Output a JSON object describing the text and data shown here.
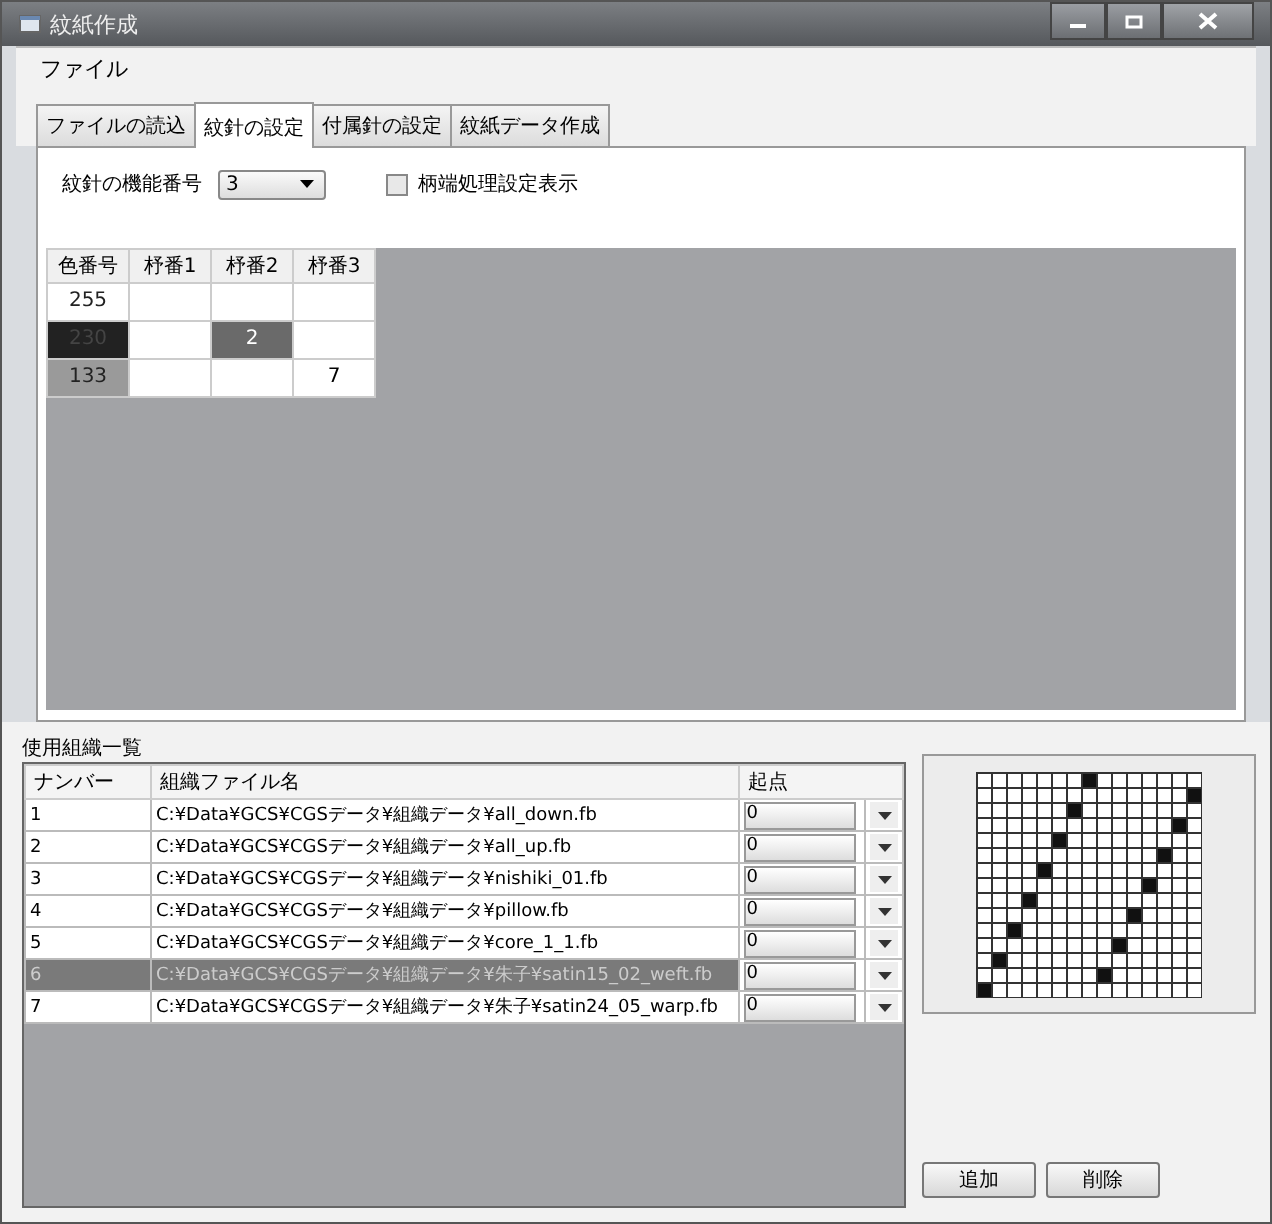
{
  "window": {
    "title": "紋紙作成"
  },
  "menu": [
    "ファイル"
  ],
  "tabs": [
    {
      "label": "ファイルの読込",
      "selected": false
    },
    {
      "label": "紋針の設定",
      "selected": true
    },
    {
      "label": "付属針の設定",
      "selected": false
    },
    {
      "label": "紋紙データ作成",
      "selected": false
    }
  ],
  "needle_function": {
    "label": "紋針の機能番号",
    "value": "3"
  },
  "edge_option": {
    "label": "柄端処理設定表示",
    "checked": false
  },
  "color_grid": {
    "columns": [
      "色番号",
      "杼番1",
      "杼番2",
      "杼番3"
    ],
    "rows": [
      {
        "color": "#ffffff",
        "cells": [
          {
            "text": "255",
            "selected": false
          },
          {
            "text": "",
            "selected": false
          },
          {
            "text": "",
            "selected": false
          },
          {
            "text": "",
            "selected": false
          }
        ]
      },
      {
        "color": "#222222",
        "cells": [
          {
            "text": "230",
            "selected": false
          },
          {
            "text": "",
            "selected": false
          },
          {
            "text": "2",
            "selected": true
          },
          {
            "text": "",
            "selected": false
          }
        ]
      },
      {
        "color": "#9a9a9a",
        "cells": [
          {
            "text": "133",
            "selected": false
          },
          {
            "text": "",
            "selected": false
          },
          {
            "text": "",
            "selected": false
          },
          {
            "text": "7",
            "selected": false
          }
        ]
      }
    ]
  },
  "weave_list": {
    "title": "使用組織一覧",
    "columns": [
      "ナンバー",
      "組織ファイル名",
      "起点"
    ],
    "rows": [
      {
        "number": "1",
        "file": "C:¥Data¥GCS¥CGSデータ¥組織データ¥all_down.fb",
        "origin": "0",
        "selected": false
      },
      {
        "number": "2",
        "file": "C:¥Data¥GCS¥CGSデータ¥組織データ¥all_up.fb",
        "origin": "0",
        "selected": false
      },
      {
        "number": "3",
        "file": "C:¥Data¥GCS¥CGSデータ¥組織データ¥nishiki_01.fb",
        "origin": "0",
        "selected": false
      },
      {
        "number": "4",
        "file": "C:¥Data¥GCS¥CGSデータ¥組織データ¥pillow.fb",
        "origin": "0",
        "selected": false
      },
      {
        "number": "5",
        "file": "C:¥Data¥GCS¥CGSデータ¥組織データ¥core_1_1.fb",
        "origin": "0",
        "selected": false
      },
      {
        "number": "6",
        "file": "C:¥Data¥GCS¥CGSデータ¥組織データ¥朱子¥satin15_02_weft.fb",
        "origin": "0",
        "selected": true
      },
      {
        "number": "7",
        "file": "C:¥Data¥GCS¥CGSデータ¥組織データ¥朱子¥satin24_05_warp.fb",
        "origin": "0",
        "selected": false
      }
    ]
  },
  "buttons": [
    "追加",
    "削除"
  ]
}
